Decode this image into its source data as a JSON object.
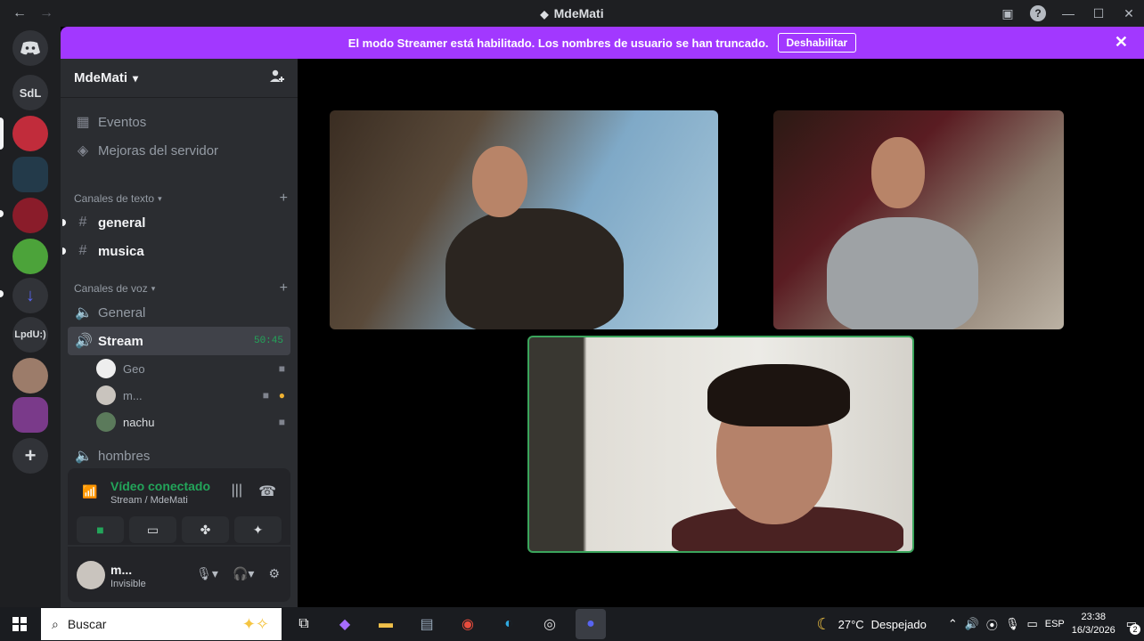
{
  "window": {
    "title": "MdeMati",
    "nav_back": "←",
    "nav_forward": "→",
    "help": "?",
    "minimize": "—",
    "maximize": "☐",
    "close": "✕"
  },
  "banner": {
    "text": "El modo Streamer está habilitado. Los nombres de usuario se han truncado.",
    "button": "Deshabilitar",
    "close": "✕"
  },
  "servers": [
    {
      "label": "",
      "icon": "discord-logo",
      "color": "#313338"
    },
    {
      "label": "SdL",
      "icon": "text",
      "color": "#313338"
    },
    {
      "label": "",
      "icon": "avatar",
      "color": "#c12c3b"
    },
    {
      "label": "",
      "icon": "avatar",
      "color": "#233a4a"
    },
    {
      "label": "",
      "icon": "avatar",
      "color": "#8a1c2a"
    },
    {
      "label": "",
      "icon": "avatar",
      "color": "#4ca33a"
    },
    {
      "label": "↓",
      "icon": "download-icon",
      "color": "#313338"
    },
    {
      "label": "LpdU:)",
      "icon": "text",
      "color": "#313338"
    },
    {
      "label": "",
      "icon": "avatar",
      "color": "#9c7c6a"
    },
    {
      "label": "",
      "icon": "avatar",
      "color": "#7a3a8a"
    },
    {
      "label": "+",
      "icon": "add-server-icon",
      "color": "#313338"
    }
  ],
  "server": {
    "name": "MdeMati",
    "chevron": "⌄",
    "add_member": "👤+"
  },
  "channels": {
    "events": "Eventos",
    "boosts": "Mejoras del servidor",
    "text_category": "Canales de texto",
    "text_channels": [
      "general",
      "musica"
    ],
    "voice_category": "Canales de voz",
    "voice_general": "General",
    "voice_stream": "Stream",
    "stream_timer": "50:45",
    "stream_users": [
      "Geo",
      "m...",
      "nachu"
    ],
    "voice_hombres": "hombres"
  },
  "voice_panel": {
    "title": "Vídeo conectado",
    "subtitle": "Stream / MdeMati"
  },
  "user_panel": {
    "name": "m...",
    "status": "Invisible"
  },
  "taskbar": {
    "search_placeholder": "Buscar",
    "weather": "27°C",
    "weather_desc": "Despejado",
    "lang": "ESP",
    "time": "23:38",
    "date": "16/3/2026",
    "notifications": "2"
  }
}
